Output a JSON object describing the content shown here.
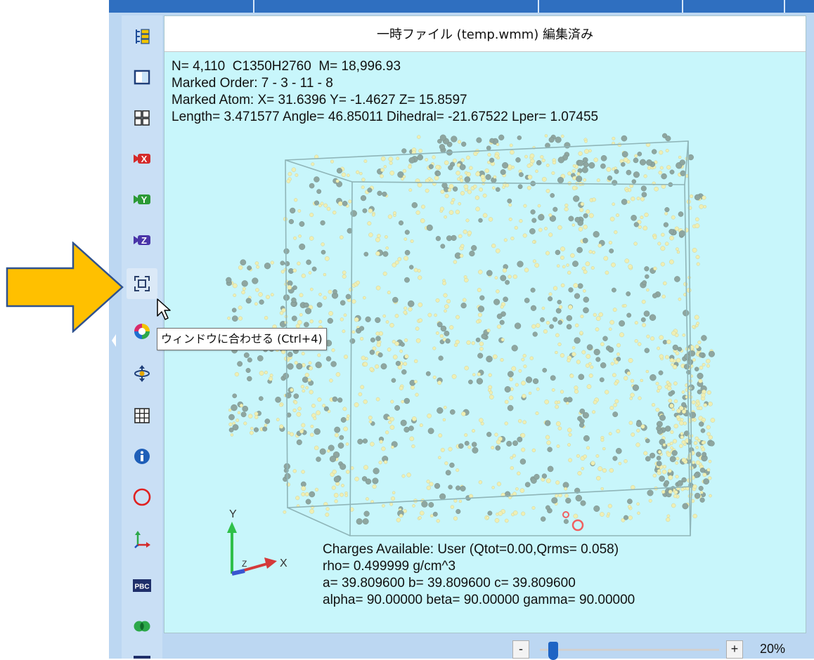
{
  "window": {
    "title": "一時ファイル (temp.wmm) 編集済み"
  },
  "toolbar": {
    "items": [
      {
        "icon": "tree-view-icon"
      },
      {
        "icon": "single-view-icon"
      },
      {
        "icon": "grid-view-icon"
      },
      {
        "icon": "camera-x-icon",
        "label": "X"
      },
      {
        "icon": "camera-y-icon",
        "label": "Y"
      },
      {
        "icon": "camera-z-icon",
        "label": "Z"
      },
      {
        "icon": "fit-to-window-icon",
        "hovered": true
      },
      {
        "icon": "color-wheel-icon"
      },
      {
        "icon": "orbit-icon"
      },
      {
        "icon": "table-icon"
      },
      {
        "icon": "info-icon"
      },
      {
        "icon": "circle-icon"
      },
      {
        "icon": "axes-icon"
      },
      {
        "icon": "pbc-icon",
        "label": "PBC"
      },
      {
        "icon": "overlap-icon"
      }
    ]
  },
  "tooltip": {
    "text": "ウィンドウに合わせる (Ctrl+4)"
  },
  "info_top": {
    "line1": "N= 4,110  C1350H2760  M= 18,996.93",
    "line2": "Marked Order: 7 - 3 - 11 - 8",
    "line3": "Marked Atom: X= 31.6396 Y= -1.4627 Z= 15.8597",
    "line4": "Length= 3.471577 Angle= 46.85011 Dihedral= -21.67522 Lper= 1.07455"
  },
  "info_bottom": {
    "line1": "Charges Available: User (Qtot=0.00,Qrms= 0.058)",
    "line2": "rho= 0.499999 g/cm^3",
    "line3": "a= 39.809600 b= 39.809600 c= 39.809600",
    "line4": "alpha= 90.00000 beta= 90.00000 gamma= 90.00000"
  },
  "axes": {
    "x_label": "X",
    "y_label": "Y",
    "z_label": "Z"
  },
  "zoom": {
    "minus_label": "-",
    "plus_label": "+",
    "value_text": "20%",
    "level": 0.2
  },
  "colors": {
    "viewport_bg": "#c8f6fb",
    "highlight_arrow": "#ffc000",
    "arrow_outline": "#2f528f",
    "atom_carbon": "#8ea6a0",
    "atom_hydrogen": "#efefb4",
    "marked_atom": "#f06060"
  }
}
